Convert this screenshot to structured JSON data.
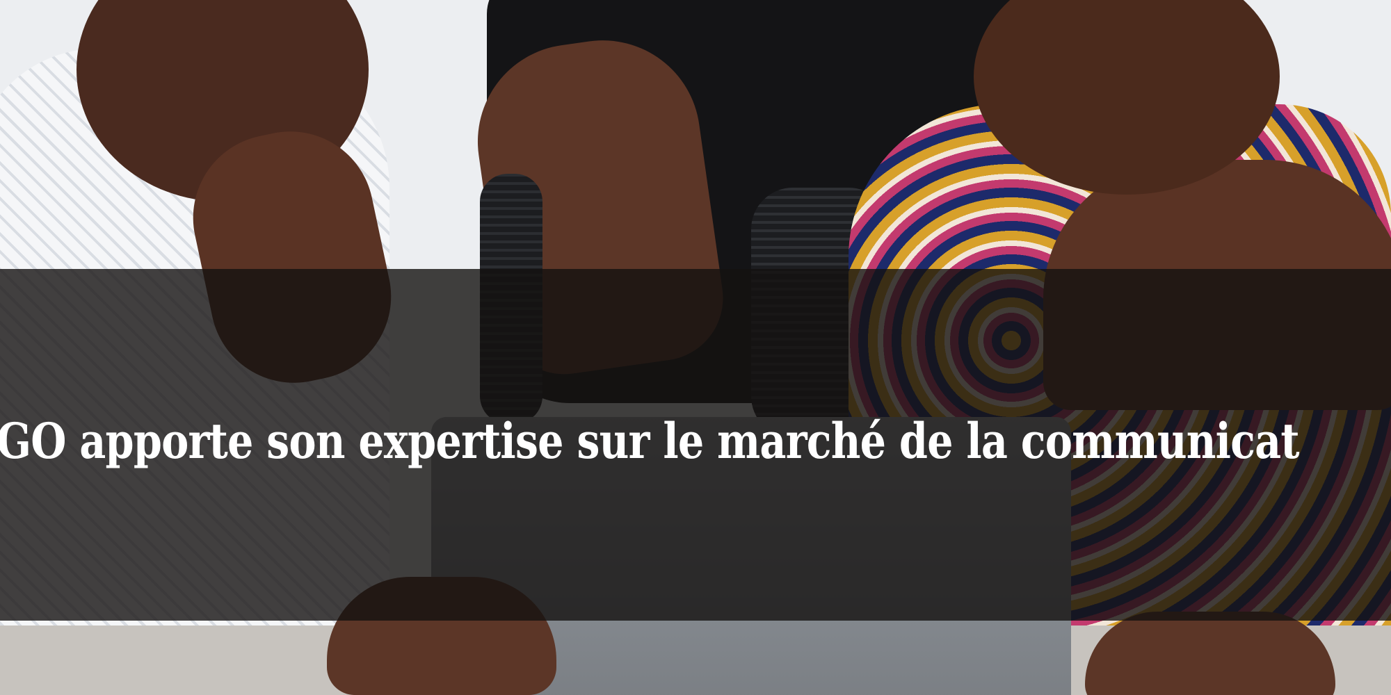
{
  "hero": {
    "headline": "NGO apporte son expertise sur le marché de la communicat"
  },
  "colors": {
    "banner_overlay": "#141210",
    "headline_text": "#ffffff"
  }
}
